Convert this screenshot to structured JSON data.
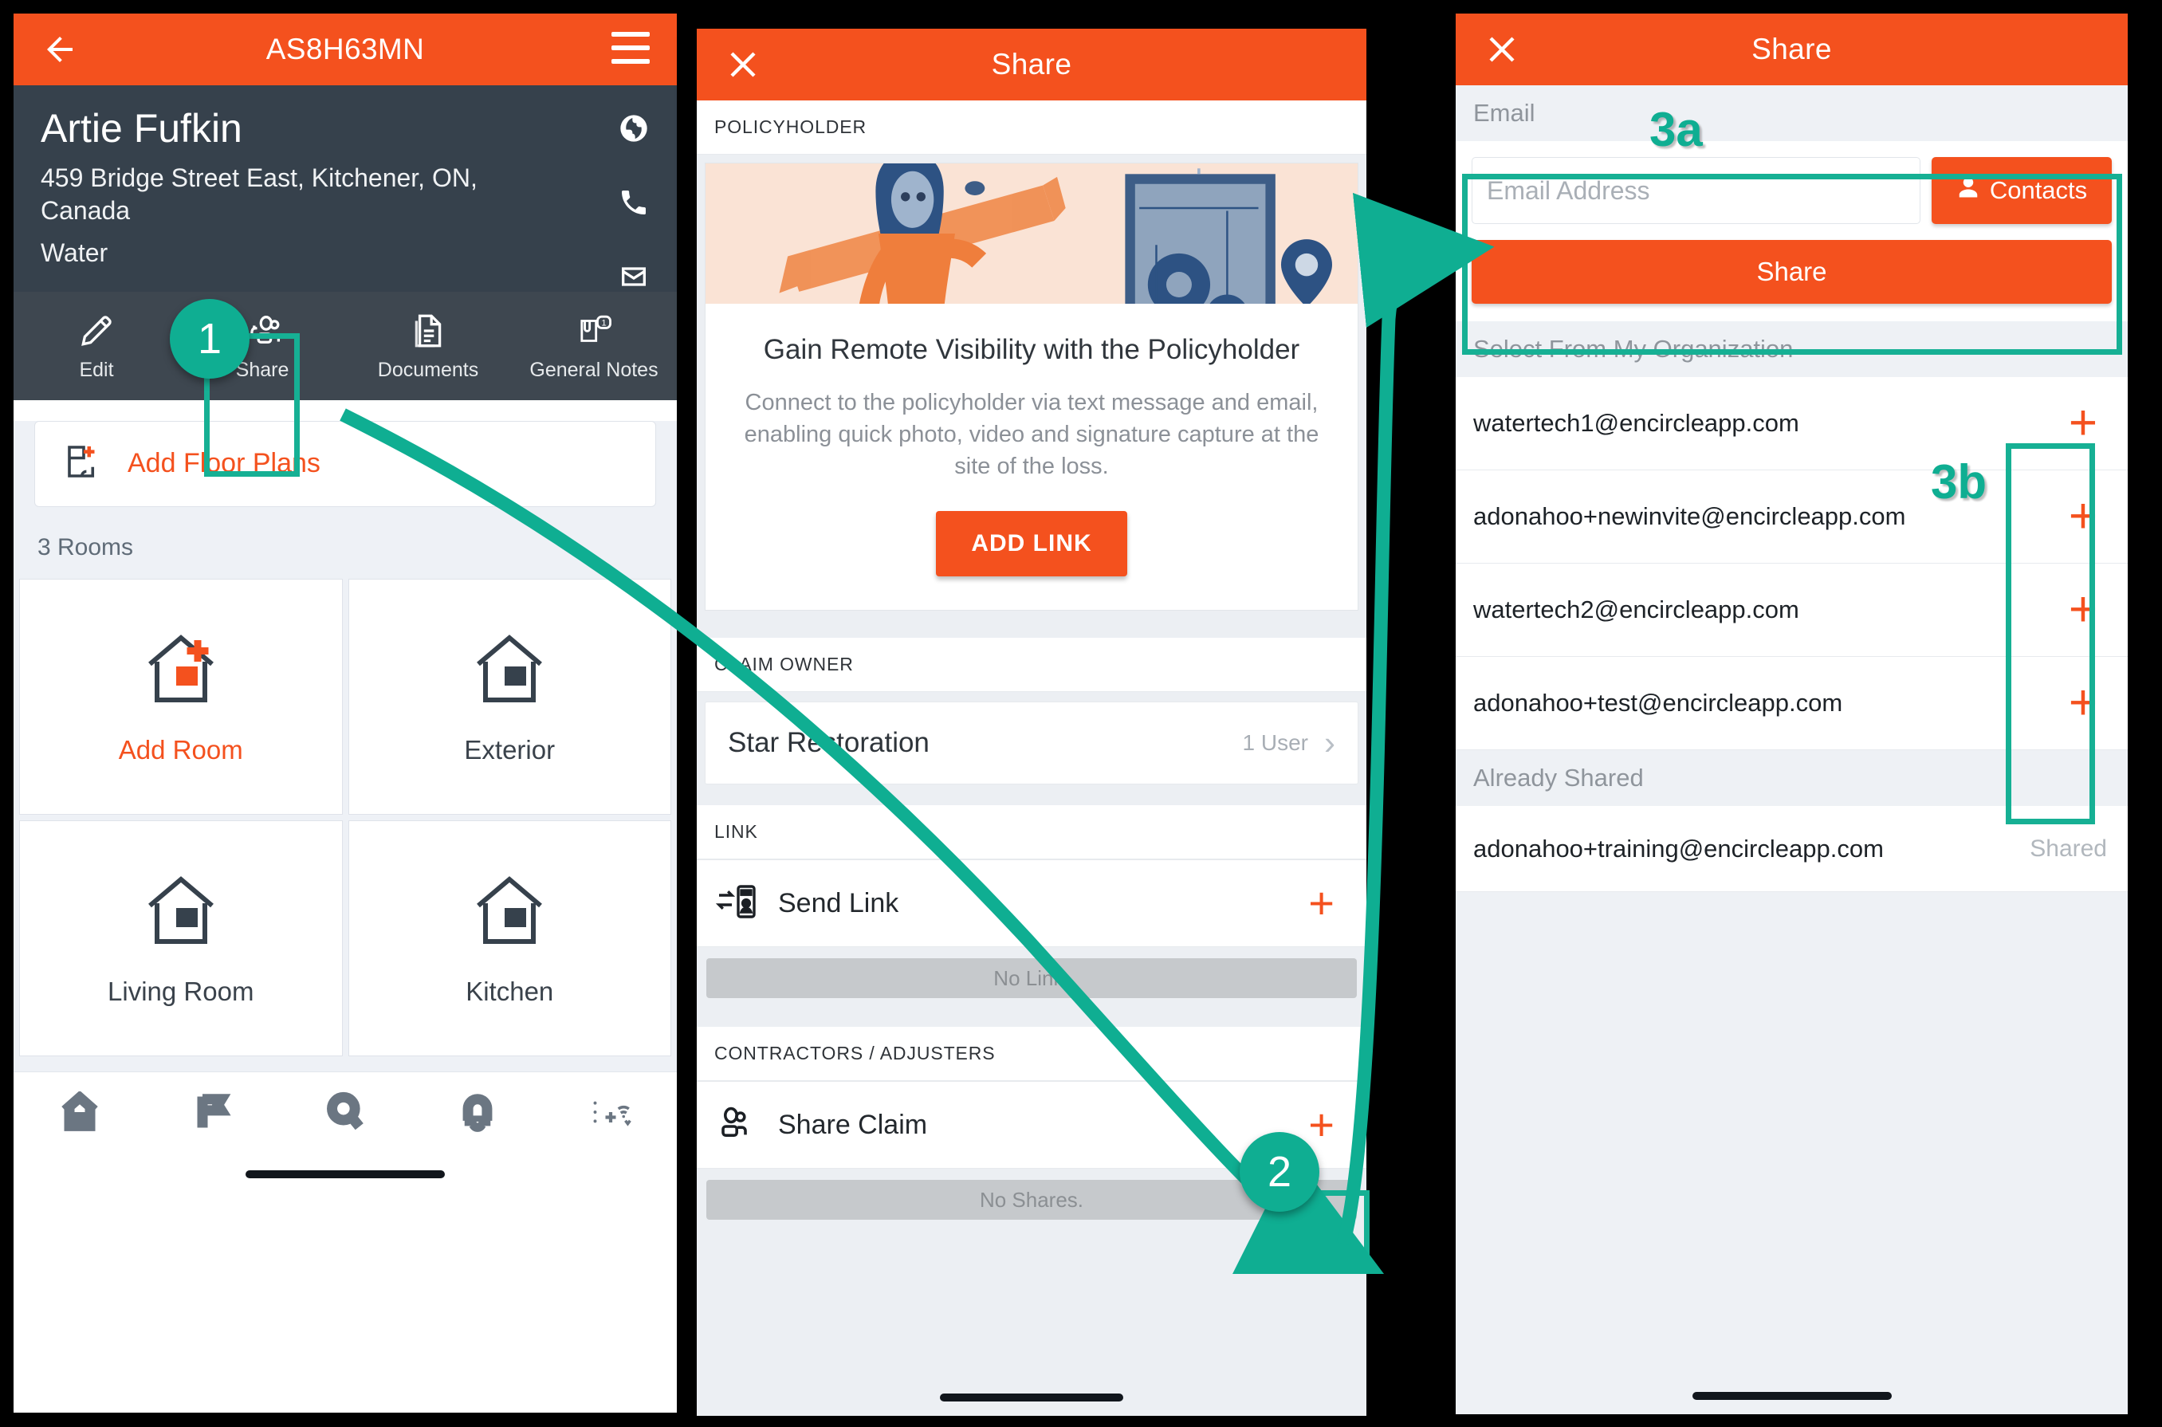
{
  "panel1": {
    "appbar": {
      "title": "AS8H63MN",
      "back_icon": "back-arrow-icon",
      "menu_icon": "hamburger-menu-icon"
    },
    "claim": {
      "name": "Artie Fufkin",
      "address": "459 Bridge Street East, Kitchener, ON, Canada",
      "loss_type": "Water"
    },
    "side_icons": [
      "globe-icon",
      "phone-icon",
      "mail-icon"
    ],
    "toolbar": [
      {
        "label": "Edit",
        "icon": "pencil-icon",
        "badge": ""
      },
      {
        "label": "Share",
        "icon": "share-people-icon",
        "badge": ""
      },
      {
        "label": "Documents",
        "icon": "documents-icon",
        "badge": ""
      },
      {
        "label": "General Notes",
        "icon": "notes-attachment-icon",
        "badge": "1"
      }
    ],
    "floor_plans_label": "Add Floor Plans",
    "rooms_count_label": "3 Rooms",
    "rooms": [
      {
        "label": "Add Room",
        "accent": true
      },
      {
        "label": "Exterior",
        "accent": false
      },
      {
        "label": "Living Room",
        "accent": false
      },
      {
        "label": "Kitchen",
        "accent": false
      }
    ],
    "bottom_nav": [
      "home-icon",
      "flag-icon",
      "search-icon",
      "bell-icon",
      "more-sync-icon"
    ]
  },
  "panel2": {
    "appbar": {
      "title": "Share",
      "close_icon": "close-x-icon"
    },
    "section_policyholder": "POLICYHOLDER",
    "promo": {
      "title": "Gain Remote Visibility with the Policyholder",
      "description": "Connect to the policyholder via text message and email, enabling quick photo, video and signature capture at the site of the loss.",
      "button": "ADD LINK"
    },
    "section_claim_owner": "CLAIM OWNER",
    "owner": {
      "name": "Star Restoration",
      "users": "1 User",
      "chevron": "chevron-right-icon"
    },
    "section_link": "LINK",
    "send_link": {
      "label": "Send Link",
      "icon": "send-link-icon",
      "action": "+"
    },
    "no_link": "No Link.",
    "section_contractors": "CONTRACTORS / ADJUSTERS",
    "share_claim": {
      "label": "Share Claim",
      "icon": "share-people-icon",
      "action": "+"
    },
    "no_shares": "No Shares."
  },
  "panel3": {
    "appbar": {
      "title": "Share",
      "close_icon": "close-x-icon"
    },
    "email_section_label": "Email",
    "email_input": {
      "value": "",
      "placeholder": "Email Address"
    },
    "contacts_button": {
      "label": "Contacts",
      "icon": "person-icon"
    },
    "share_button": "Share",
    "org_section_label": "Select From My Organization",
    "org_members": [
      {
        "email": "watertech1@encircleapp.com",
        "action": "+"
      },
      {
        "email": "adonahoo+newinvite@encircleapp.com",
        "action": "+"
      },
      {
        "email": "watertech2@encircleapp.com",
        "action": "+"
      },
      {
        "email": "adonahoo+test@encircleapp.com",
        "action": "+"
      }
    ],
    "already_shared_label": "Already Shared",
    "already_shared": [
      {
        "email": "adonahoo+training@encircleapp.com",
        "status": "Shared"
      }
    ]
  },
  "annotations": {
    "step1": "1",
    "step2": "2",
    "step3a": "3a",
    "step3b": "3b"
  },
  "colors": {
    "brand_orange": "#f4511e",
    "dark_slate": "#36414c",
    "toolbar_slate": "#3e4750",
    "annotation_teal": "#0fae92",
    "page_bg": "#eef1f5"
  }
}
